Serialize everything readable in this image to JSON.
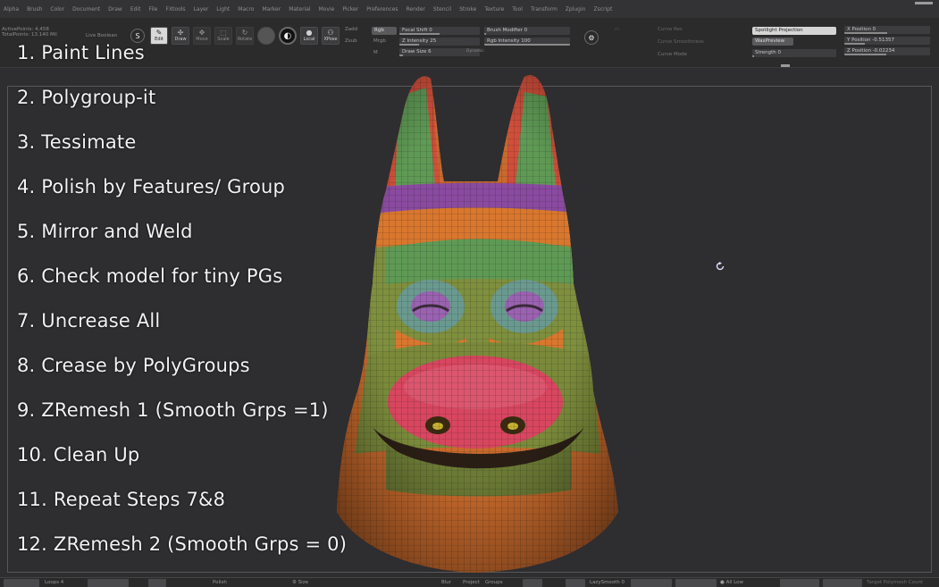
{
  "menu": [
    "Alpha",
    "Brush",
    "Color",
    "Document",
    "Draw",
    "Edit",
    "File",
    "FXtools",
    "Layer",
    "Light",
    "Macro",
    "Marker",
    "Material",
    "Movie",
    "Picker",
    "Preferences",
    "Render",
    "Stencil",
    "Stroke",
    "Texture",
    "Tool",
    "Transform",
    "Zplugin",
    "Zscript"
  ],
  "stats": {
    "active_points": "ActivePoints: 4,458",
    "total_points": "TotalPoints: 13.140 Mil"
  },
  "toolbar": {
    "live_boolean": "Live Boolean",
    "edit": "Edit",
    "draw": "Draw",
    "move": "Move",
    "scale": "Scale",
    "rotate": "Rotate",
    "local": "Local",
    "xpose": "XPose",
    "zadd": "Zadd",
    "zsub": "Zsub",
    "mrgb": "Mrgb",
    "rgb": "Rgb",
    "m": "M",
    "focal_shift": "Focal Shift 0",
    "z_intensity": "Z Intensity 25",
    "draw_size": "Draw Size 6",
    "dynamic": "Dynamic",
    "brush_modifier": "Brush Modifier 0",
    "rgb_intensity": "Rgb Intensity 100",
    "curve_res": "Curve Res",
    "curve_smoothness": "Curve Smoothness",
    "curve_mode": "Curve Mode",
    "spotlight_projection": "Spotlight Projection",
    "wax_preview": "WaxPreview",
    "strength": "Strength 0",
    "x_position": "X Position 0",
    "y_position": "Y Position -0.51357",
    "z_position": "Z Position -0.02234"
  },
  "steps": [
    "1. Paint Lines",
    "2. Polygroup-it",
    "3. Tessimate",
    "4. Polish by Features/ Group",
    "5. Mirror and Weld",
    "6. Check model for tiny PGs",
    "7. Uncrease All",
    "8. Crease by PolyGroups",
    "9. ZRemesh 1 (Smooth Grps =1)",
    "10. Clean Up",
    "11. Repeat Steps 7&8",
    "12. ZRemesh 2 (Smooth Grps = 0)"
  ],
  "bottom": {
    "loops": "Loops 4",
    "polish": "Polish",
    "size": "Size",
    "blur": "Blur",
    "project": "Project",
    "groups": "Groups",
    "lazysmooth": "LazySmooth 0",
    "all_low": "All Low",
    "target_polymesh_count": "Target Polymesh Count"
  },
  "colors": {
    "viewport_bg": "#2e2d30",
    "step_text": "#f2f2f2",
    "pg_green": "#5f9a55",
    "pg_orange": "#d9772e",
    "pg_purple": "#8a4aa0",
    "pg_red": "#d8465f",
    "pg_teal": "#6a9a8f"
  }
}
